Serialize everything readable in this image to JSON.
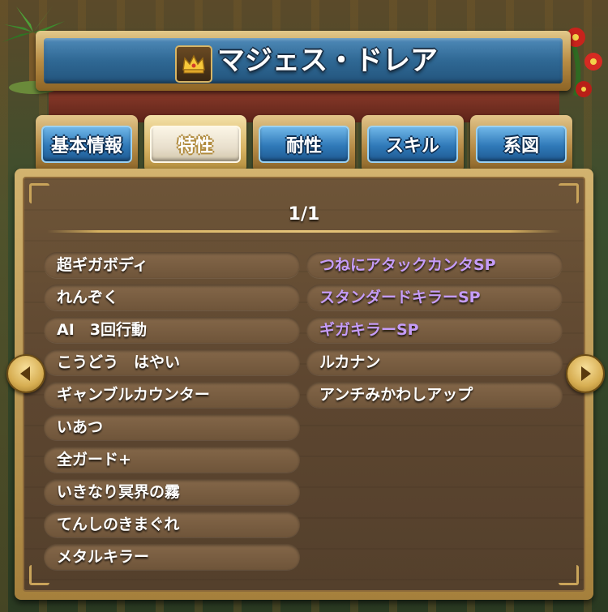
{
  "title": "マジェス・ドレア",
  "icons": {
    "title_icon": "crown-icon",
    "prev": "arrow-left-icon",
    "next": "arrow-right-icon"
  },
  "tabs": [
    {
      "label": "基本情報",
      "active": false
    },
    {
      "label": "特性",
      "active": true
    },
    {
      "label": "耐性",
      "active": false
    },
    {
      "label": "スキル",
      "active": false
    },
    {
      "label": "系図",
      "active": false
    }
  ],
  "page_indicator": "1/1",
  "traits_left": [
    "超ギガボディ",
    "れんぞく",
    "AI　3回行動",
    "こうどう　はやい",
    "ギャンブルカウンター",
    "いあつ",
    "全ガード+",
    "いきなり冥界の霧",
    "てんしのきまぐれ",
    "メタルキラー"
  ],
  "traits_right": [
    "つねにアタックカンタSP",
    "スタンダードキラーSP",
    "ギガキラーSP",
    "ルカナン",
    "アンチみかわしアップ"
  ],
  "colors": {
    "sp_trait": "#c59cf8",
    "normal_trait": "#ffffff",
    "tab_blue": "#2f79b8",
    "panel_wood": "#5d4630"
  }
}
